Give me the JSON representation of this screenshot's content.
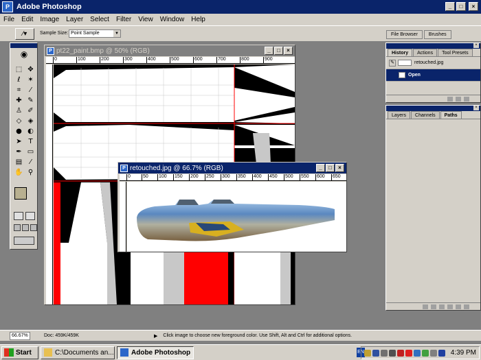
{
  "app": {
    "title": "Adobe Photoshop",
    "logo_letter": "P"
  },
  "window_buttons": [
    "_",
    "□",
    "×"
  ],
  "menu": [
    "File",
    "Edit",
    "Image",
    "Layer",
    "Select",
    "Filter",
    "View",
    "Window",
    "Help"
  ],
  "options_bar": {
    "sample_size_label": "Sample Size:",
    "sample_size_value": "Point Sample",
    "well_tabs": [
      "File Browser",
      "Brushes"
    ]
  },
  "doc1": {
    "title": "pt22_paint.bmp @ 50% (RGB)",
    "ruler": [
      "0",
      "100",
      "200",
      "300",
      "400",
      "500",
      "600",
      "700",
      "800",
      "900"
    ]
  },
  "doc2": {
    "title": "retouched.jpg @ 66.7% (RGB)",
    "ruler": [
      "0",
      "50",
      "100",
      "150",
      "200",
      "250",
      "300",
      "350",
      "400",
      "450",
      "500",
      "550",
      "600",
      "650"
    ]
  },
  "history_panel": {
    "tabs": [
      "History",
      "Actions",
      "Tool Presets"
    ],
    "snapshot_name": "retouched.jpg",
    "steps": [
      {
        "label": "Open",
        "selected": true
      }
    ]
  },
  "layers_panel": {
    "tabs": [
      "Layers",
      "Channels",
      "Paths"
    ],
    "active_tab": "Paths"
  },
  "status": {
    "zoom": "66.67%",
    "doc_size": "Doc: 459K/459K",
    "hint": "Click image to choose new foreground color.  Use Shift, Alt and Ctrl for additional options."
  },
  "taskbar": {
    "start": "Start",
    "tasks": [
      {
        "label": "C:\\Documents an...",
        "active": false
      },
      {
        "label": "Adobe Photoshop",
        "active": true
      }
    ],
    "lang": "EN",
    "clock": "4:39 PM"
  },
  "colors": {
    "title_active": "#0a246a",
    "chrome": "#d4d0c8",
    "workspace": "#808080",
    "paint_red": "#ff0000",
    "fg_swatch": "#b8b090"
  }
}
